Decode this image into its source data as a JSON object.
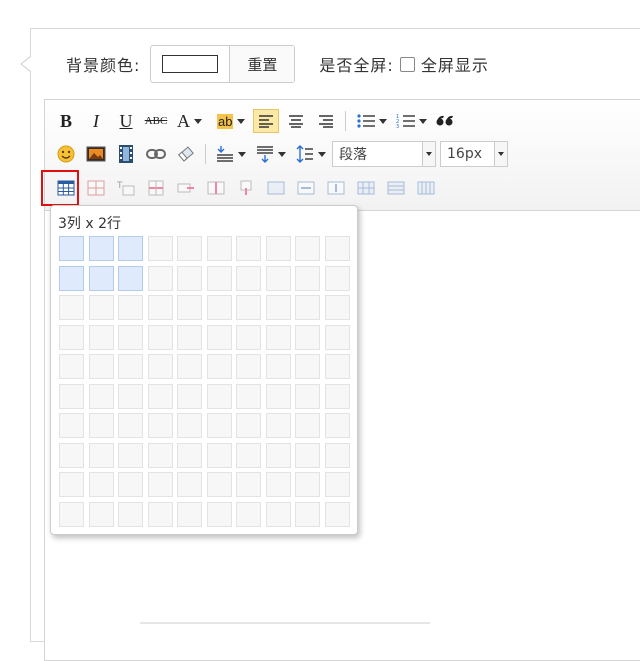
{
  "settings": {
    "bg_label": "背景颜色:",
    "reset_label": "重置",
    "fullscreen_label": "是否全屏:",
    "fullscreen_option": "全屏显示",
    "fullscreen_checked": false,
    "bg_color": "#ffffff"
  },
  "toolbar": {
    "bold": "B",
    "italic": "I",
    "underline": "U",
    "strike": "ABC",
    "font_color": "A",
    "highlight": "ab",
    "paragraph_select": "段落",
    "fontsize_select": "16px",
    "active_color": "#fde9a6"
  },
  "picker": {
    "label": "3列 x 2行",
    "cols": 10,
    "rows": 10,
    "selected_cols": 3,
    "selected_rows": 2
  },
  "colors": {
    "highlight_border": "#e01010",
    "selected_cell": "#dfeafc"
  }
}
